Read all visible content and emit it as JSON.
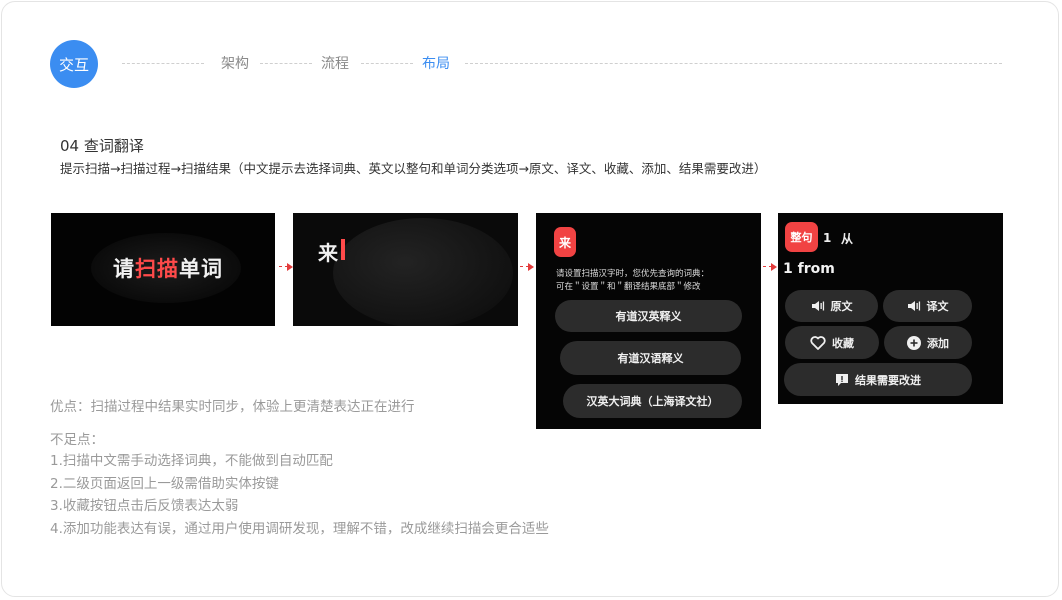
{
  "nav": {
    "circle": "交互",
    "items": [
      "架构",
      "流程",
      "布局"
    ],
    "active_index": 2
  },
  "section": {
    "title": "04 查词翻译",
    "description": "提示扫描→扫描过程→扫描结果（中文提示去选择词典、英文以整句和单词分类选项→原文、译文、收藏、添加、结果需要改进）"
  },
  "screens": {
    "prompt": {
      "prefix": "请",
      "highlight": "扫描",
      "suffix": "单词"
    },
    "scanning": {
      "char": "来"
    },
    "chinese_result": {
      "badge": "来",
      "hint_line1": "请设置扫描汉字时，您优先查询的词典：",
      "hint_line2": "可在＂设置＂和＂翻译结果底部＂修改",
      "options": [
        "有道汉英释义",
        "有道汉语释义",
        "汉英大词典（上海译文社）"
      ]
    },
    "english_result": {
      "badge": "整句",
      "num": "1",
      "char": "从",
      "word": "1 from",
      "buttons": {
        "original": "原文",
        "translation": "译文",
        "favorite": "收藏",
        "add": "添加",
        "feedback": "结果需要改进"
      }
    }
  },
  "pros": "优点：扫描过程中结果实时同步，体验上更清楚表达正在进行",
  "cons": {
    "title": "不足点：",
    "items": [
      "1.扫描中文需手动选择词典，不能做到自动匹配",
      "2.二级页面返回上一级需借助实体按键",
      "3.收藏按钮点击后反馈表达太弱",
      "4.添加功能表达有误，通过用户使用调研发现，理解不错，改成继续扫描会更合适些"
    ]
  },
  "colors": {
    "accent": "#3b8df1",
    "highlight_red": "#ff4a4a",
    "badge_red": "#f14343"
  },
  "icons": [
    "speaker-icon",
    "heart-icon",
    "plus-circle-icon",
    "feedback-icon",
    "arrow-right-icon"
  ]
}
